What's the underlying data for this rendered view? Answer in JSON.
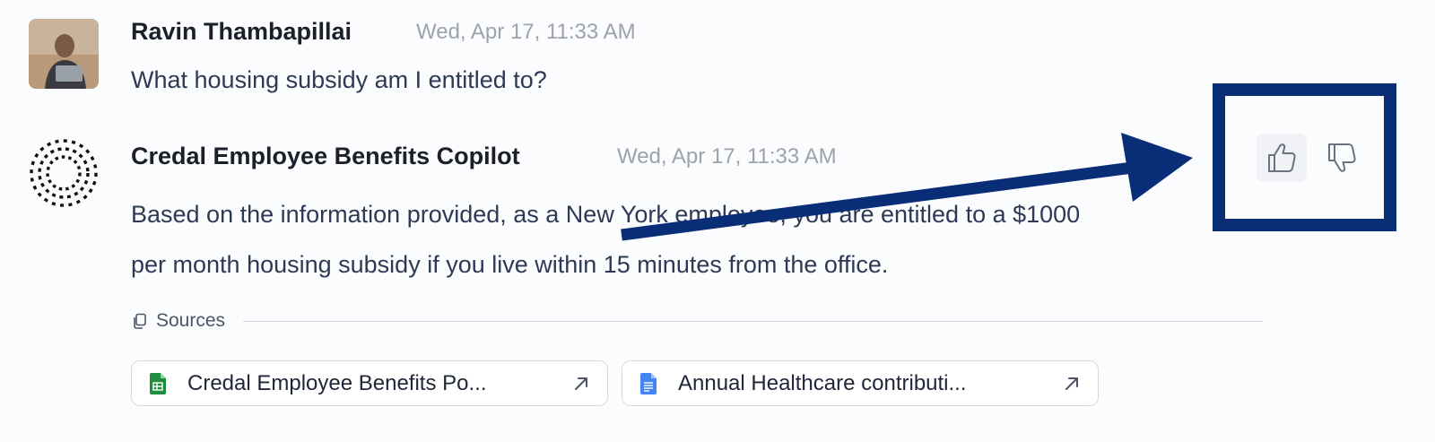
{
  "user_message": {
    "author": "Ravin Thambapillai",
    "timestamp": "Wed, Apr 17, 11:33 AM",
    "text": "What housing subsidy am I entitled to?"
  },
  "bot_message": {
    "author": "Credal Employee Benefits Copilot",
    "timestamp": "Wed, Apr 17, 11:33 AM",
    "text_line1": "Based on the information provided, as a New York employee, you are entitled to a $1000",
    "text_line2": "per month housing subsidy if you live within 15 minutes from the office."
  },
  "sources": {
    "label": "Sources",
    "items": [
      {
        "label": "Credal Employee Benefits Po...",
        "icon": "google-sheets-icon"
      },
      {
        "label": "Annual Healthcare contributi...",
        "icon": "google-docs-icon"
      }
    ]
  },
  "feedback": {
    "thumbs_up": "thumbs-up-icon",
    "thumbs_down": "thumbs-down-icon"
  },
  "colors": {
    "annotation": "#0a2d78",
    "sheets_green": "#1e8e3e",
    "docs_blue": "#4285f4"
  }
}
